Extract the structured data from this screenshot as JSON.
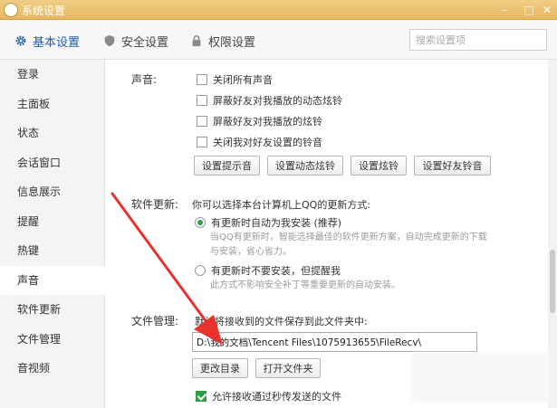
{
  "window": {
    "title": "系统设置"
  },
  "tabs": [
    {
      "label": "基本设置",
      "icon": "gear-icon"
    },
    {
      "label": "安全设置",
      "icon": "shield-icon"
    },
    {
      "label": "权限设置",
      "icon": "lock-icon"
    }
  ],
  "search": {
    "placeholder": "搜索设置项"
  },
  "sidebar": {
    "items": [
      {
        "label": "登录"
      },
      {
        "label": "主面板"
      },
      {
        "label": "状态"
      },
      {
        "label": "会话窗口"
      },
      {
        "label": "信息展示"
      },
      {
        "label": "提醒"
      },
      {
        "label": "热键"
      },
      {
        "label": "声音"
      },
      {
        "label": "软件更新"
      },
      {
        "label": "文件管理"
      },
      {
        "label": "音视频"
      }
    ],
    "active": "声音"
  },
  "sound": {
    "label": "声音:",
    "options": [
      {
        "label": "关闭所有声音",
        "checked": false
      },
      {
        "label": "屏蔽好友对我播放的动态炫铃",
        "checked": false
      },
      {
        "label": "屏蔽好友对我播放的炫铃",
        "checked": false
      },
      {
        "label": "关闭我对好友设置的铃音",
        "checked": false
      }
    ],
    "buttons": [
      "设置提示音",
      "设置动态炫铃",
      "设置炫铃",
      "设置好友铃音"
    ]
  },
  "update": {
    "label": "软件更新:",
    "intro": "你可以选择本台计算机上QQ的更新方式:",
    "options": [
      {
        "label": "有更新时自动为我安装 (推荐)",
        "selected": true,
        "hint_line1": "当QQ有更新时，智能选择最佳的软件更新方案，自动完成更新的下载",
        "hint_line2": "与安装，省心省力。"
      },
      {
        "label": "有更新时不要安装，但提醒我",
        "selected": false,
        "hint_line1": "此方式不影响安全补丁等重要更新的自动安装。"
      }
    ]
  },
  "files": {
    "label": "文件管理:",
    "intro": "默认将接收到的文件保存到此文件夹中:",
    "path": "D:\\我的文档\\Tencent Files\\1075913655\\FileRecv\\",
    "change_dir": "更改目录",
    "open_folder": "打开文件夹",
    "allow_label": "允许接收通过秒传发送的文件",
    "allow_checked": true
  },
  "colors": {
    "titlebar": "#e7b763",
    "accent": "#1f5fa8",
    "check": "#2e9e47",
    "arrow": "#e8322e"
  }
}
